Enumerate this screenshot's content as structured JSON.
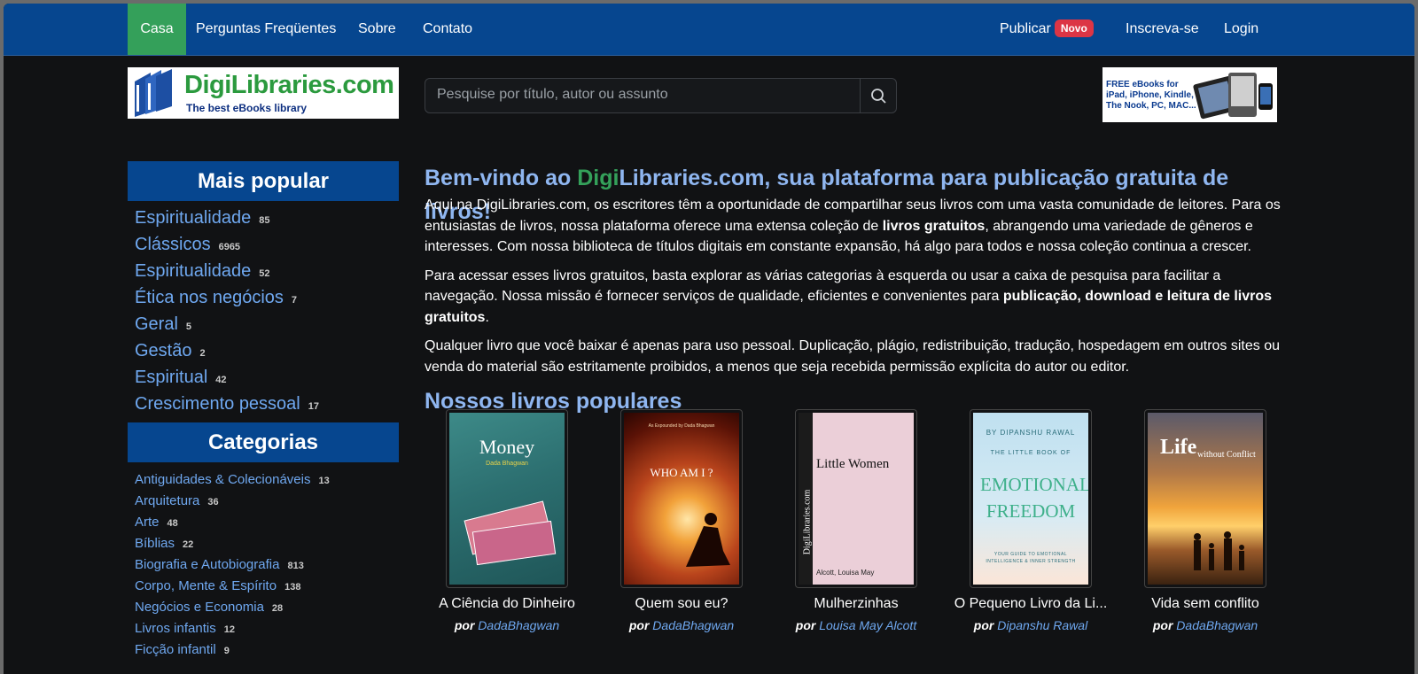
{
  "nav": {
    "home": "Casa",
    "faq": "Perguntas Freqüentes",
    "about": "Sobre",
    "contact": "Contato",
    "publish": "Publicar",
    "publish_badge": "Novo",
    "signup": "Inscreva-se",
    "login": "Login"
  },
  "logo": {
    "brand_green": "DigiLibraries.com",
    "tagline": "The best eBooks library"
  },
  "search": {
    "placeholder": "Pesquise por título, autor ou assunto",
    "icon": "search-icon"
  },
  "ad": {
    "line1": "FREE eBooks for",
    "line2": "iPad, iPhone, Kindle,",
    "line3": "The Nook, PC, MAC..."
  },
  "sidebar": {
    "popular_title": "Mais popular",
    "popular": [
      {
        "label": "Espiritualidade",
        "count": "85"
      },
      {
        "label": "Clássicos",
        "count": "6965"
      },
      {
        "label": "Espiritualidade",
        "count": "52"
      },
      {
        "label": "Ética nos negócios",
        "count": "7"
      },
      {
        "label": "Geral",
        "count": "5"
      },
      {
        "label": "Gestão",
        "count": "2"
      },
      {
        "label": "Espiritual",
        "count": "42"
      },
      {
        "label": "Crescimento pessoal",
        "count": "17"
      }
    ],
    "categories_title": "Categorias",
    "categories": [
      {
        "label": "Antiguidades & Colecionáveis",
        "count": "13"
      },
      {
        "label": "Arquitetura",
        "count": "36"
      },
      {
        "label": "Arte",
        "count": "48"
      },
      {
        "label": "Bíblias",
        "count": "22"
      },
      {
        "label": "Biografia e Autobiografia",
        "count": "813"
      },
      {
        "label": "Corpo, Mente & Espírito",
        "count": "138"
      },
      {
        "label": "Negócios e Economia",
        "count": "28"
      },
      {
        "label": "Livros infantis",
        "count": "12"
      },
      {
        "label": "Ficção infantil",
        "count": "9"
      }
    ]
  },
  "main": {
    "title_pre": "Bem-vindo ao ",
    "title_digi": "Digi",
    "title_post": "Libraries.com, sua plataforma para publicação gratuita de livros!",
    "p1a": "Aqui na DigiLibraries.com, os escritores têm a oportunidade de compartilhar seus livros com uma vasta comunidade de leitores. Para os entusiastas de livros, nossa plataforma oferece uma extensa coleção de ",
    "p1b": "livros gratuitos",
    "p1c": ", abrangendo uma variedade de gêneros e interesses. Com nossa biblioteca de títulos digitais em constante expansão, há algo para todos e nossa coleção continua a crescer.",
    "p2a": "Para acessar esses livros gratuitos, basta explorar as várias categorias à esquerda ou usar a caixa de pesquisa para facilitar a navegação. Nossa missão é fornecer serviços de qualidade, eficientes e convenientes para ",
    "p2b": "publicação, download e leitura de livros gratuitos",
    "p2c": ".",
    "p3": "Qualquer livro que você baixar é apenas para uso pessoal. Duplicação, plágio, redistribuição, tradução, hospedagem em outros sites ou venda do material são estritamente proibidos, a menos que seja recebida permissão explícita do autor ou editor.",
    "popular_title": "Nossos livros populares"
  },
  "books": [
    {
      "title": "A Ciência do Dinheiro",
      "by": "por",
      "author": "DadaBhagwan",
      "cover_text": "Money",
      "cover_sub": "Dada Bhagwan"
    },
    {
      "title": "Quem sou eu?",
      "by": "por",
      "author": "DadaBhagwan",
      "cover_text": "WHO AM I ?",
      "cover_sub": "As Expounded by Dada Bhagwan"
    },
    {
      "title": "Mulherzinhas",
      "by": "por",
      "author": "Louisa May Alcott",
      "cover_text": "Little Women",
      "cover_sub": "Alcott, Louisa May",
      "cover_side": "DigiLibraries.com"
    },
    {
      "title": "O Pequeno Livro da Li...",
      "by": "por",
      "author": "Dipanshu Rawal",
      "cover_text": "EMOTIONAL FREEDOM",
      "cover_top": "BY DIPANSHU RAWAL",
      "cover_sub": "THE LITTLE BOOK OF",
      "cover_foot": "YOUR GUIDE TO EMOTIONAL INTELLIGENCE & INNER STRENGTH"
    },
    {
      "title": "Vida sem conflito",
      "by": "por",
      "author": "DadaBhagwan",
      "cover_text": "Life",
      "cover_sub": "without Conflict"
    }
  ]
}
